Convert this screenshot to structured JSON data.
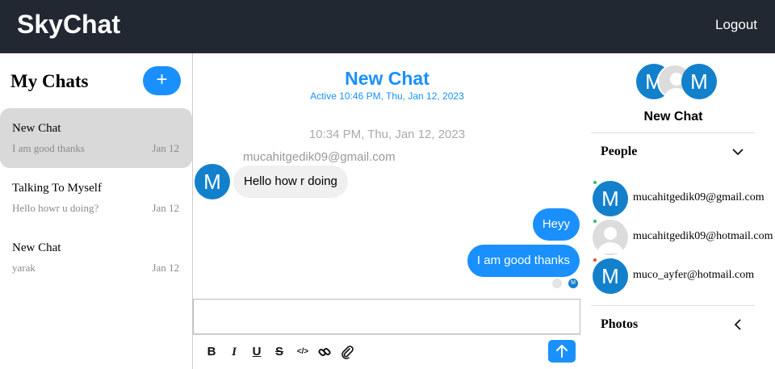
{
  "header": {
    "brand": "SkyChat",
    "logout_label": "Logout"
  },
  "chat_list": {
    "title": "My Chats",
    "add_label": "+",
    "items": [
      {
        "title": "New Chat",
        "last_message": "I am good thanks",
        "date": "Jan 12",
        "active": true
      },
      {
        "title": "Talking To Myself",
        "last_message": "Hello howr u doing?",
        "date": "Jan 12",
        "active": false
      },
      {
        "title": "New Chat",
        "last_message": "yarak",
        "date": "Jan 12",
        "active": false
      }
    ]
  },
  "chat_feed": {
    "title": "New Chat",
    "subtitle": "Active 10:46 PM, Thu, Jan 12, 2023",
    "timestamp": "10:34 PM, Thu, Jan 12, 2023",
    "incoming": {
      "sender": "mucahitgedik09@gmail.com",
      "avatar_letter": "M",
      "text": "Hello how r doing"
    },
    "outgoing": [
      {
        "text": "Heyy"
      },
      {
        "text": "I am good thanks"
      }
    ],
    "read_receipt_letter": "M",
    "composer_placeholder": "",
    "toolbar_icons": [
      "bold-icon",
      "italic-icon",
      "underline-icon",
      "strikethrough-icon",
      "code-icon",
      "link-icon",
      "attachment-icon"
    ],
    "tool_labels": {
      "bold": "B",
      "italic": "I",
      "underline": "U",
      "strike": "S",
      "code": "</>"
    }
  },
  "chat_settings": {
    "avatar_letter": "M",
    "title": "New Chat",
    "people_label": "People",
    "photos_label": "Photos",
    "people": [
      {
        "email": "mucahitgedik09@gmail.com",
        "avatar_letter": "M",
        "status_color": "#22c55e",
        "has_photo": true
      },
      {
        "email": "mucahitgedik09@hotmail.com",
        "avatar_letter": "",
        "status_color": "#22c55e",
        "has_photo": false
      },
      {
        "email": "muco_ayfer@hotmail.com",
        "avatar_letter": "M",
        "status_color": "#ef4444",
        "has_photo": true
      }
    ]
  },
  "colors": {
    "accent": "#1a90ff",
    "topbar": "#222831",
    "avatar": "#1380cc"
  }
}
